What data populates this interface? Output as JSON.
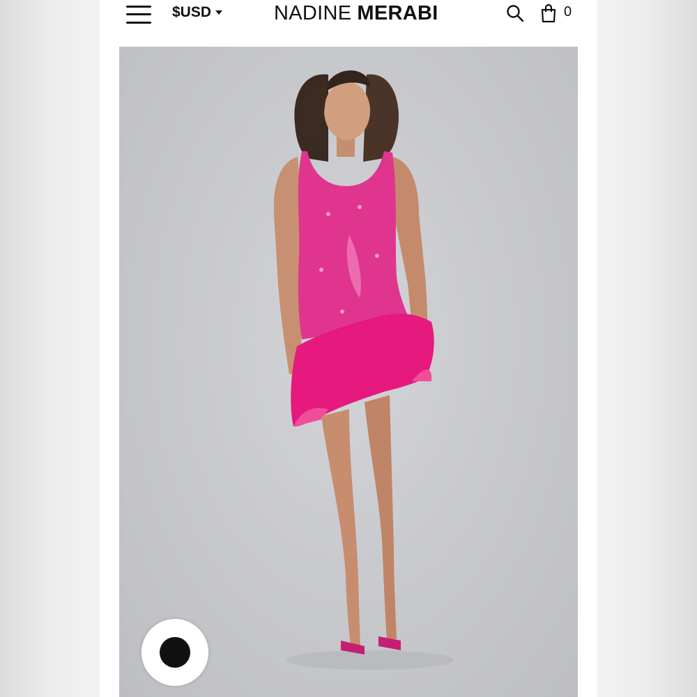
{
  "header": {
    "menu_icon": "hamburger-menu-icon",
    "currency_label": "$USD",
    "brand_first": "NADINE",
    "brand_last": "MERABI",
    "search_icon": "search-icon",
    "bag_icon": "shopping-bag-icon",
    "cart_count": "0"
  },
  "hero": {
    "image": "model-in-pink-sequin-feather-mini-dress",
    "accent_color": "#e0358f"
  },
  "chat": {
    "icon": "chat-icon"
  }
}
